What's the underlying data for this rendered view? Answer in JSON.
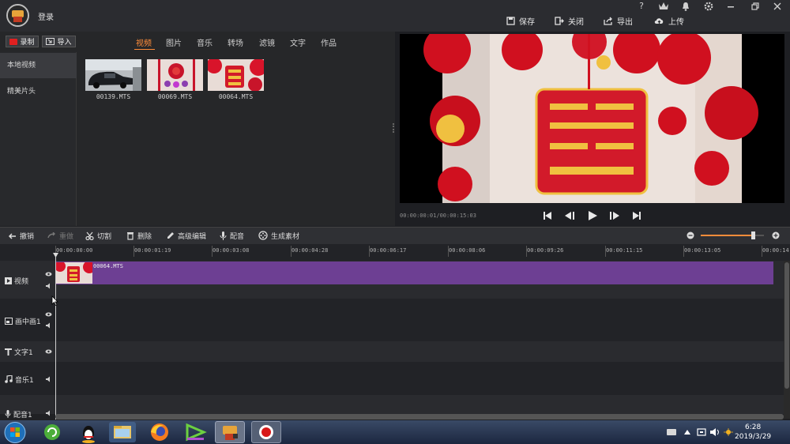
{
  "titlebar": {
    "login": "登录",
    "window_help": "?",
    "actions": [
      "保存",
      "关闭",
      "导出",
      "上传"
    ]
  },
  "source": {
    "record_label": "录制",
    "import_label": "导入",
    "tabs": [
      "视频",
      "图片",
      "音乐",
      "转场",
      "滤镜",
      "文字",
      "作品"
    ],
    "active_tab": "视频",
    "sidebar": [
      "本地视频",
      "精美片头"
    ],
    "files": [
      "00139.MTS",
      "00069.MTS",
      "00064.MTS"
    ]
  },
  "player": {
    "timecode": "00:00:00:01/00:00:15:03"
  },
  "toolbar": {
    "undo": "撤销",
    "redo": "重做",
    "cut": "切割",
    "delete": "删除",
    "advanced": "高级编辑",
    "dub": "配音",
    "generate": "生成素材",
    "zoom_level": 0.83
  },
  "ruler": {
    "ticks": [
      "00:00:00:00",
      "00:00:01:19",
      "00:00:03:08",
      "00:00:04:28",
      "00:00:06:17",
      "00:00:08:06",
      "00:00:09:26",
      "00:00:11:15",
      "00:00:13:05",
      "00:00:14:"
    ]
  },
  "tracks": [
    "视频",
    "画中画1",
    "文字1",
    "音乐1",
    "配音1"
  ],
  "clip": {
    "name": "00064.MTS"
  },
  "taskbar": {
    "time": "6:28",
    "date": "2019/3/29"
  },
  "colors": {
    "accent": "#ff8c3a",
    "clip": "#6d3f93",
    "record": "#e02020"
  }
}
